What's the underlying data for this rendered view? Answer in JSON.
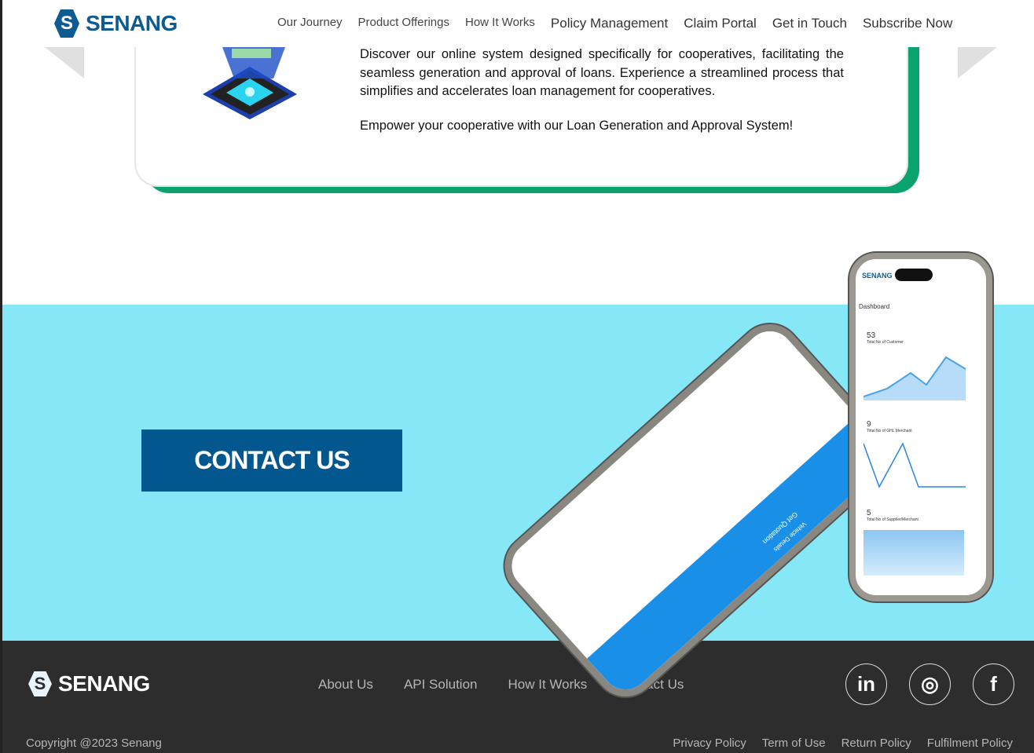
{
  "header": {
    "logo": "SENANG",
    "logo_letter": "S",
    "nav": [
      "Our Journey",
      "Product Offerings",
      "How It Works",
      "Policy Management",
      "Claim Portal",
      "Get in Touch",
      "Subscribe Now"
    ]
  },
  "card": {
    "paragraph1": "Discover our online system designed specifically for cooperatives, facilitating the seamless generation and approval of loans. Experience a streamlined process that simplifies and accelerates loan management for cooperatives.",
    "paragraph2": "Empower your cooperative with our Loan Generation and Approval System!"
  },
  "cta": {
    "label": "CONTACT US"
  },
  "phone": {
    "logo": "SENANG",
    "dashboard": "Dashboard",
    "stats": [
      {
        "value": "53",
        "label": "Total No of Customer"
      },
      {
        "value": "9",
        "label": "Total No of GHL Merchant"
      },
      {
        "value": "5",
        "label": "Total No of Supplier/Merchant"
      }
    ],
    "quote_title": "Get Quotation",
    "vehicle_details": "Vehicle Details"
  },
  "footer": {
    "logo": "SENANG",
    "logo_letter": "S",
    "nav": [
      "About Us",
      "API Solution",
      "How It Works",
      "Contact Us"
    ],
    "social": [
      {
        "icon": "linkedin-icon",
        "glyph": "in"
      },
      {
        "icon": "instagram-icon",
        "glyph": "◎"
      },
      {
        "icon": "facebook-icon",
        "glyph": "f"
      }
    ],
    "copyright": "Copyright @2023 Senang",
    "legal": [
      "Privacy Policy",
      "Term of Use",
      "Return Policy",
      "Fulfilment Policy"
    ]
  },
  "colors": {
    "brand": "#0e5a93",
    "accent_green": "#0aa36d",
    "band": "#86e8f7",
    "footer": "#2d2d2d",
    "cta": "#03578f"
  }
}
